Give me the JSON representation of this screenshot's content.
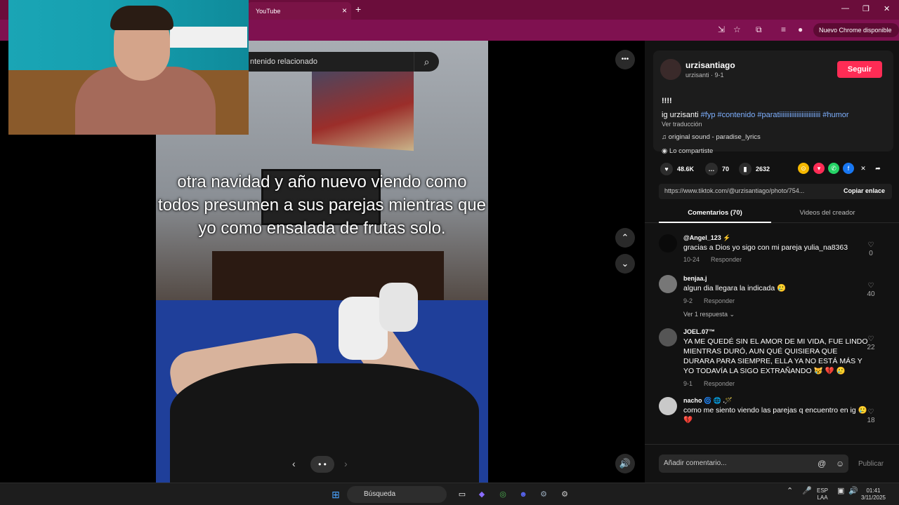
{
  "browser": {
    "tab_title": "YouTube",
    "tab_close": "×",
    "new_tab": "+",
    "update_button": "Nuevo Chrome disponible",
    "window_minimize": "—",
    "window_restore": "❐",
    "window_close": "✕"
  },
  "search": {
    "placeholder": "ntenido relacionado",
    "icon": "search-icon"
  },
  "post": {
    "caption": "otra navidad y año nuevo viendo como todos presumen a sus parejas mientras que yo como ensalada de frutas solo.",
    "slide_prev": "‹",
    "slide_next": "›",
    "slide_dots": "• •",
    "more_button": "•••"
  },
  "author": {
    "username": "urzisantiago",
    "sub": "urzisanti · 9-1",
    "follow_label": "Seguir",
    "follow_color": "#fe2c55"
  },
  "description": {
    "title": "!!!!",
    "prefix": "ig urzisanti ",
    "tags": "#fyp #contenido #paratiiiiiiiiiiiiiiiiiiiiiiii #humor",
    "translate": "Ver traducción",
    "music": "original sound - paradise_lyrics",
    "shared": "Lo compartiste"
  },
  "stats": {
    "likes": "48.6K",
    "comments": "70",
    "saves": "2632"
  },
  "link": {
    "url": "https://www.tiktok.com/@urzisantiago/photo/754...",
    "copy_label": "Copiar enlace"
  },
  "tabs": {
    "comments": "Comentarios (70)",
    "creator_videos": "Videos del creador"
  },
  "comments": [
    {
      "user": "@Angel_123 ⚡",
      "text": "gracias a Dios yo sigo con mi pareja yulia_na8363",
      "date": "10-24",
      "reply": "Responder",
      "likes": "0"
    },
    {
      "user": "benjaa.j",
      "text": "algun dia llegara la indicada 🥲",
      "date": "9-2",
      "reply": "Responder",
      "likes": "40",
      "more": "Ver 1 respuesta ⌄"
    },
    {
      "user": "JOEL.07™",
      "text": "YA ME QUEDÉ SIN EL AMOR DE MI VIDA, FUE LINDO MIENTRAS DURÓ, AUN QUÉ QUISIERA QUE DURARA PARA SIEMPRE, ELLA YA NO ESTÁ MÁS Y YO TODAVÍA LA SIGO EXTRAÑANDO 😿 💔 🥲",
      "date": "9-1",
      "reply": "Responder",
      "likes": "22"
    },
    {
      "user": "nacho 🌀 🌐 .🪄",
      "text": "como me siento viendo las parejas q encuentro en ig 🥲 💔",
      "date": "",
      "reply": "",
      "likes": "18"
    }
  ],
  "add_comment": {
    "placeholder": "Añadir comentario...",
    "mention_icon": "@",
    "emoji_icon": "☺",
    "publish_label": "Publicar"
  },
  "taskbar": {
    "search_label": "Búsqueda",
    "lang_top": "ESP",
    "lang_bottom": "LAA",
    "time": "01:41",
    "date": "3/11/2025"
  }
}
